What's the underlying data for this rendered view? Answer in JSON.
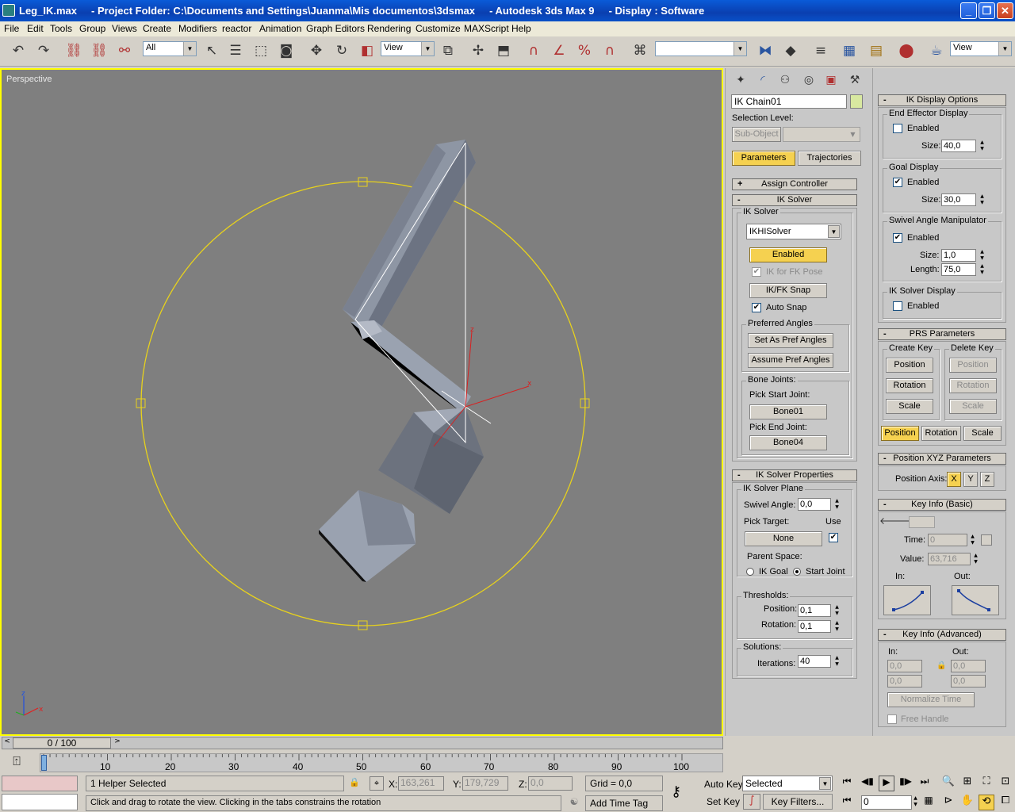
{
  "window": {
    "title": "Leg_IK.max     - Project Folder: C:\\Documents and Settings\\Juanma\\Mis documentos\\3dsmax     - Autodesk 3ds Max 9     - Display : Software"
  },
  "menu": [
    "File",
    "Edit",
    "Tools",
    "Group",
    "Views",
    "Create",
    "Modifiers",
    "reactor",
    "Animation",
    "Graph Editors",
    "Rendering",
    "Customize",
    "MAXScript",
    "Help"
  ],
  "toolbar": {
    "selection_filter": "All",
    "ref_coord": "View",
    "named_sel": "",
    "render_view": "View"
  },
  "viewport": {
    "label": "Perspective"
  },
  "command_panel": {
    "object_name": "IK Chain01",
    "object_color": "#d8e8a0",
    "selection_level_label": "Selection Level:",
    "subobject_label": "Sub-Object",
    "tabs": [
      "Parameters",
      "Trajectories"
    ],
    "assign_controller": "Assign Controller",
    "ik_solver_rollout": "IK Solver",
    "ik_solver_group": "IK Solver",
    "solver_value": "IKHISolver",
    "enabled_button": "Enabled",
    "ik_for_fk": "IK for FK Pose",
    "ikfk_snap": "IK/FK Snap",
    "auto_snap": "Auto Snap",
    "preferred_angles": "Preferred Angles",
    "set_pref": "Set As Pref Angles",
    "assume_pref": "Assume Pref Angles",
    "bone_joints": "Bone Joints:",
    "pick_start": "Pick Start Joint:",
    "start_bone": "Bone01",
    "pick_end": "Pick End Joint:",
    "end_bone": "Bone04",
    "solver_props_rollout": "IK Solver Properties",
    "solver_plane": "IK Solver Plane",
    "swivel_label": "Swivel Angle:",
    "swivel_value": "0,0",
    "pick_target": "Pick Target:",
    "use_label": "Use",
    "target_value": "None",
    "parent_space": "Parent Space:",
    "ik_goal": "IK Goal",
    "start_joint": "Start Joint",
    "thresholds": "Thresholds:",
    "position_label": "Position:",
    "position_value": "0,1",
    "rotation_label": "Rotation:",
    "rotation_value": "0,1",
    "solutions": "Solutions:",
    "iterations_label": "Iterations:",
    "iterations_value": "40"
  },
  "right_panel": {
    "ik_display_rollout": "IK Display Options",
    "end_effector": "End Effector Display",
    "enabled": "Enabled",
    "size": "Size:",
    "ee_size": "40,0",
    "goal_display": "Goal Display",
    "goal_size": "30,0",
    "swivel_manip": "Swivel Angle Manipulator",
    "swivel_size": "1,0",
    "length": "Length:",
    "swivel_length": "75,0",
    "solver_display": "IK Solver Display",
    "prs_rollout": "PRS Parameters",
    "create_key": "Create Key",
    "delete_key": "Delete Key",
    "position": "Position",
    "rotation": "Rotation",
    "scale": "Scale",
    "pos_xyz_rollout": "Position XYZ Parameters",
    "position_axis": "Position Axis:",
    "axes": [
      "X",
      "Y",
      "Z"
    ],
    "keyinfo_basic": "Key Info (Basic)",
    "time": "Time:",
    "time_value": "0",
    "value": "Value:",
    "value_value": "63,716",
    "in": "In:",
    "out": "Out:",
    "keyinfo_adv": "Key Info (Advanced)",
    "adv_in": "In:",
    "adv_out": "Out:",
    "zero": "0,0",
    "normalize_time": "Normalize Time",
    "free_handle": "Free Handle"
  },
  "timeline": {
    "slider_label": "0 / 100",
    "ticks": [
      "0",
      "10",
      "20",
      "30",
      "40",
      "50",
      "60",
      "70",
      "80",
      "90",
      "100"
    ]
  },
  "status": {
    "selection": "1 Helper Selected",
    "prompt": "Click and drag to rotate the view.  Clicking in the tabs constrains the rotation",
    "x_label": "X:",
    "x": "163,261",
    "y_label": "Y:",
    "y": "179,729",
    "z_label": "Z:",
    "z": "0,0",
    "grid": "Grid = 0,0",
    "add_time_tag": "Add Time Tag",
    "auto_key": "Auto Key",
    "set_key": "Set Key",
    "selected": "Selected",
    "key_filters": "Key Filters...",
    "frame": "0"
  }
}
